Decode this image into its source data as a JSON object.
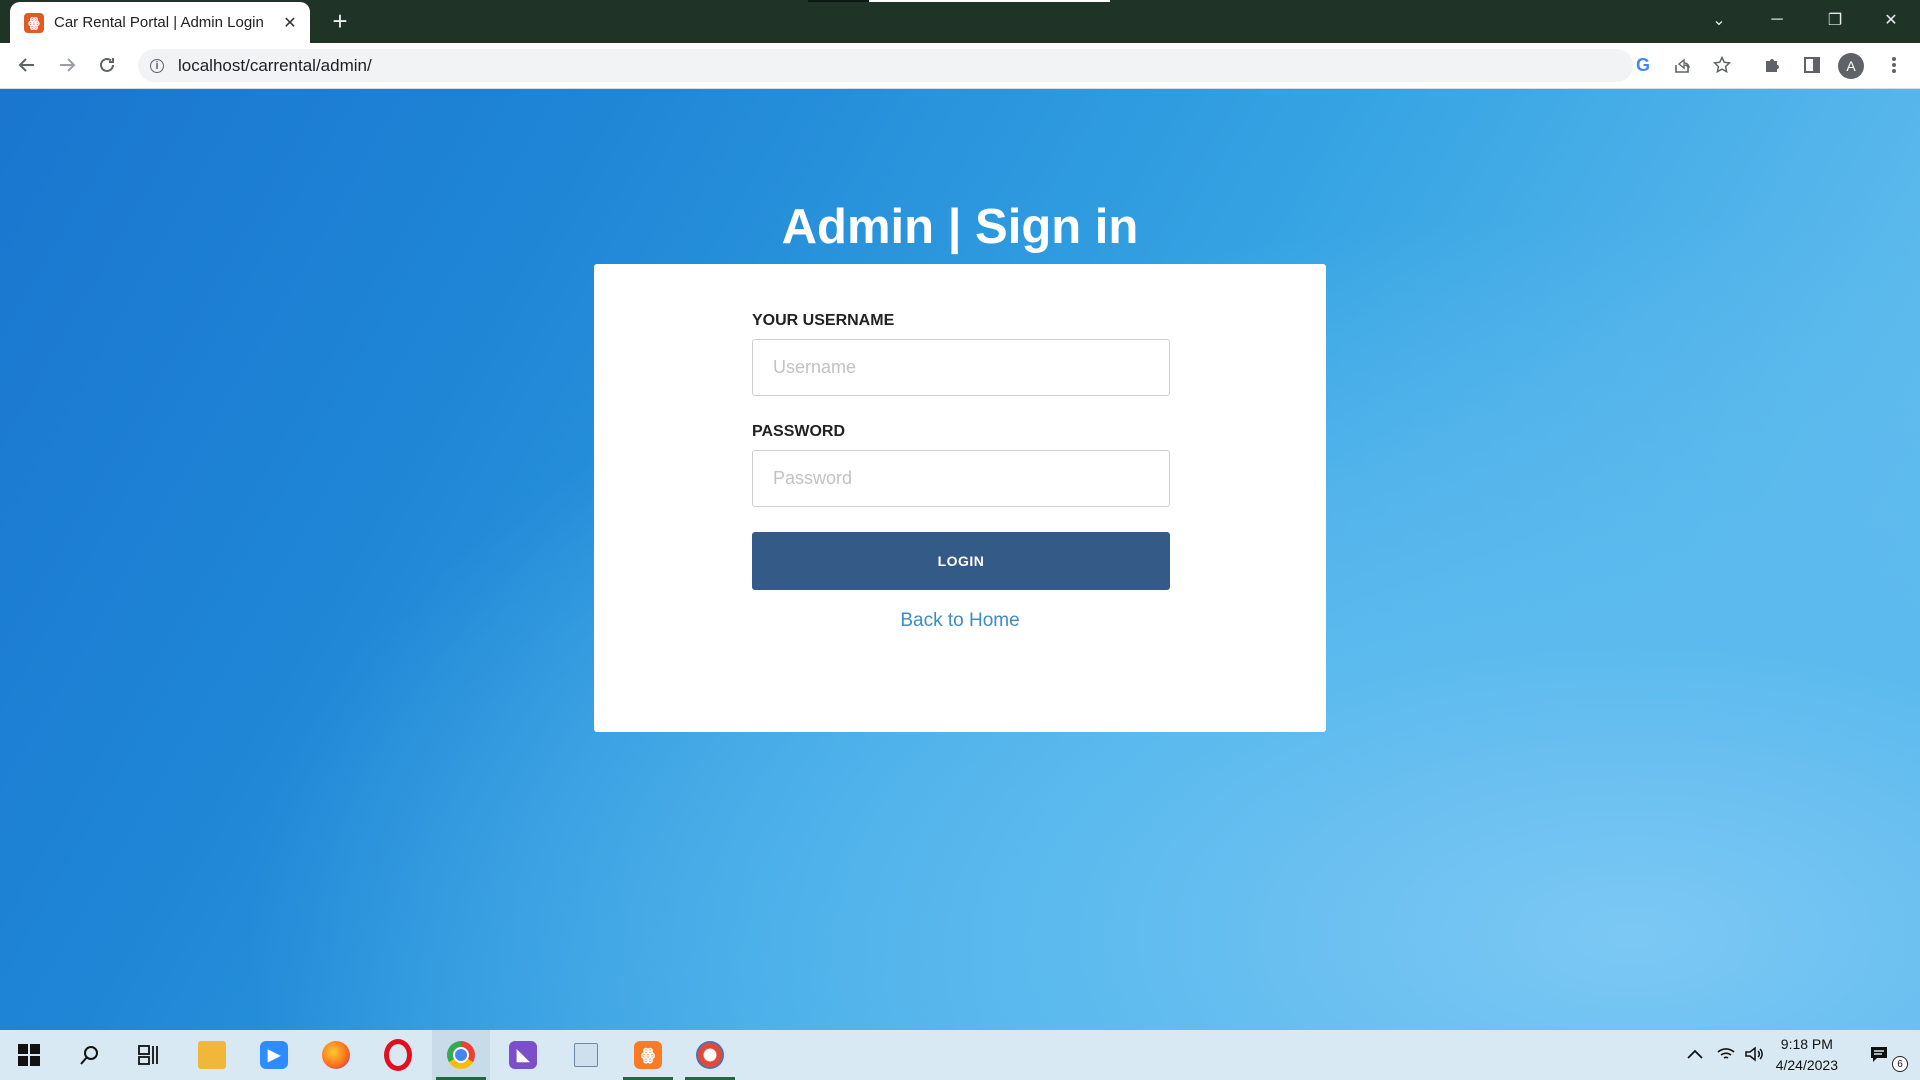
{
  "browser": {
    "tab_title": "Car Rental Portal | Admin Login",
    "tab_close": "✕",
    "new_tab": "+",
    "url": "localhost/carrental/admin/",
    "profile_initial": "A",
    "window_controls": {
      "list": "⌄",
      "minimize": "─",
      "restore": "❐",
      "close": "✕"
    }
  },
  "page": {
    "title": "Admin | Sign in",
    "username_label": "YOUR USERNAME",
    "username_placeholder": "Username",
    "username_value": "",
    "password_label": "PASSWORD",
    "password_placeholder": "Password",
    "password_value": "",
    "login_label": "LOGIN",
    "back_link": "Back to Home"
  },
  "taskbar": {
    "time": "9:18 PM",
    "date": "4/24/2023",
    "notification_count": "6",
    "apps": [
      "start",
      "search",
      "task-view",
      "file-explorer",
      "zoom",
      "firefox",
      "opera",
      "chrome",
      "visual-studio",
      "app-window",
      "xampp",
      "paint-tool"
    ],
    "active_apps": [
      "chrome",
      "xampp",
      "paint-tool"
    ]
  },
  "colors": {
    "tab_strip": "#1f3327",
    "page_gradient_start": "#1a76cf",
    "page_gradient_end": "#72c4f0",
    "login_button": "#345a87",
    "link": "#3c8dc5"
  }
}
